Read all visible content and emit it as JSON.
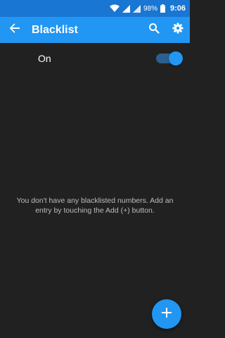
{
  "status_bar": {
    "battery": "98%",
    "time": "9:06",
    "icons": [
      "wifi-icon",
      "signal-icon",
      "signal-icon",
      "battery-icon"
    ]
  },
  "app_bar": {
    "title": "Blacklist",
    "back_icon": "back-arrow-icon",
    "actions": [
      "search-icon",
      "gear-icon"
    ],
    "color": "#2196f3"
  },
  "switch": {
    "label": "On",
    "checked": true
  },
  "empty_state": {
    "message": "You don't have any blacklisted numbers. Add an entry by touching the Add (+) button."
  },
  "fab": {
    "icon": "plus-icon",
    "color": "#2196f3"
  }
}
